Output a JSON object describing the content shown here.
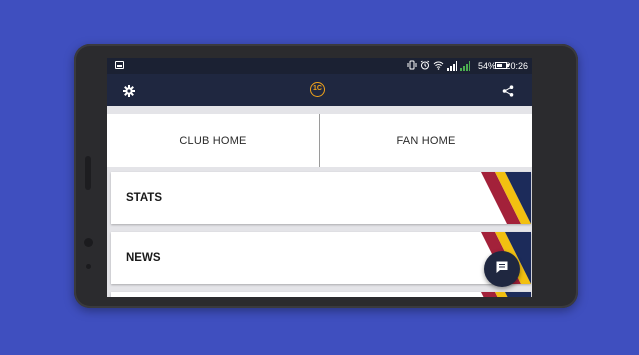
{
  "status_bar": {
    "battery_percent": "54%",
    "time": "20:26",
    "icons": [
      "image-icon",
      "vibrate-icon",
      "alarm-icon",
      "wifi-icon",
      "signal-icon",
      "battery-icon"
    ]
  },
  "app_bar": {
    "logo_text": "1C",
    "icons": [
      "gear-icon",
      "share-icon"
    ],
    "logo_color": "#f0a21a"
  },
  "top_buttons": {
    "club_home": "CLUB HOME",
    "fan_home": "FAN HOME"
  },
  "cards": [
    {
      "label": "STATS"
    },
    {
      "label": "NEWS"
    },
    {
      "label": ""
    }
  ],
  "fab": {
    "icon": "chat-icon"
  },
  "colors": {
    "background": "#3f4fbf",
    "app_bar": "#1f2740",
    "stripe_red": "#a3213a",
    "stripe_yellow": "#f2c011",
    "stripe_navy": "#1c2b5a"
  }
}
